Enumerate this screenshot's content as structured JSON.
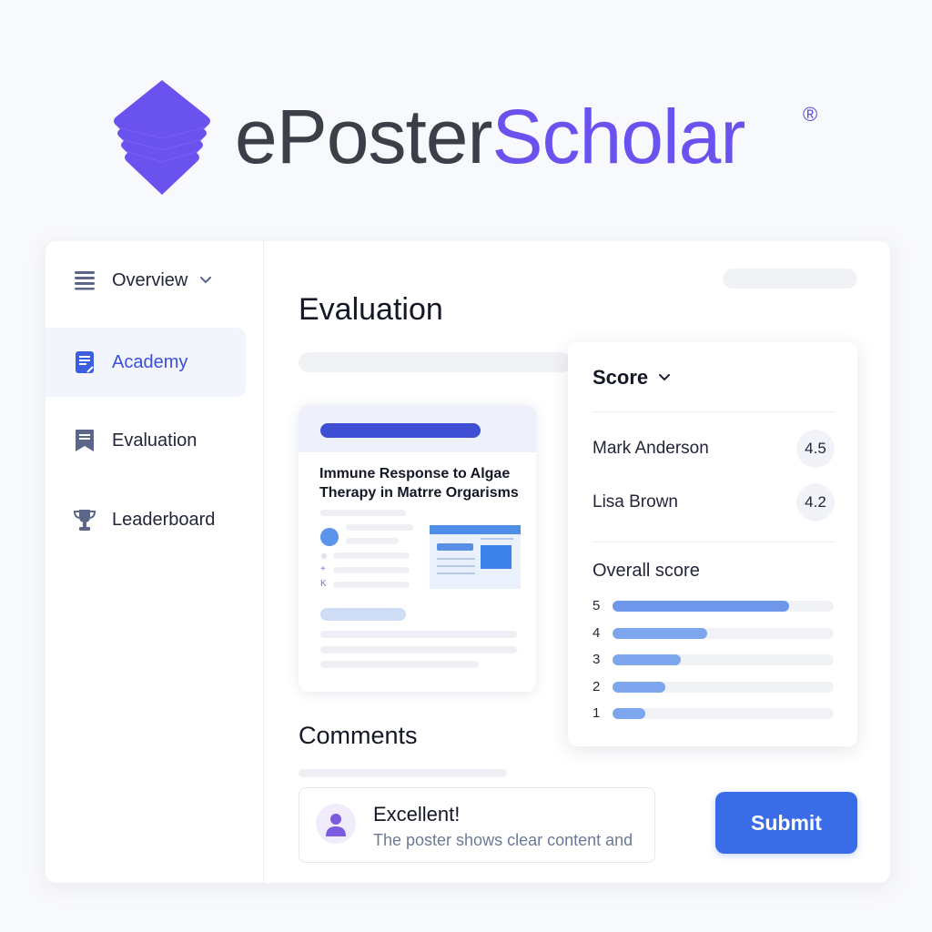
{
  "brand": {
    "name_part1": "ePoster",
    "name_part2": "Scholar",
    "registered": "®",
    "logo_icon": "stacked-hexagon-logo",
    "colors": {
      "dark": "#3d3f48",
      "accent": "#6a52ee"
    }
  },
  "sidebar": {
    "items": [
      {
        "label": "Overview",
        "icon": "menu-lines-icon",
        "has_dropdown": true
      },
      {
        "label": "Academy",
        "icon": "document-icon",
        "active": true
      },
      {
        "label": "Evaluation",
        "icon": "bookmark-icon"
      },
      {
        "label": "Leaderboard",
        "icon": "trophy-icon"
      }
    ]
  },
  "main": {
    "title": "Evaluation",
    "poster": {
      "title": "Immune Response to Algae Therapy in Matrre Orgarisms",
      "mini_labels": [
        "+",
        "K"
      ]
    },
    "score_panel": {
      "title": "Score",
      "reviewers": [
        {
          "name": "Mark Anderson",
          "score": "4.5"
        },
        {
          "name": "Lisa Brown",
          "score": "4.2"
        }
      ],
      "overall_label": "Overall score",
      "distribution": [
        {
          "star": "5",
          "fraction": 0.8
        },
        {
          "star": "4",
          "fraction": 0.43
        },
        {
          "star": "3",
          "fraction": 0.31
        },
        {
          "star": "2",
          "fraction": 0.24
        },
        {
          "star": "1",
          "fraction": 0.15
        }
      ]
    },
    "comments": {
      "title": "Comments",
      "comment_title": "Excellent!",
      "comment_text": "The poster shows clear content and"
    },
    "submit_label": "Submit",
    "accent_color": "#3a6ce8"
  }
}
